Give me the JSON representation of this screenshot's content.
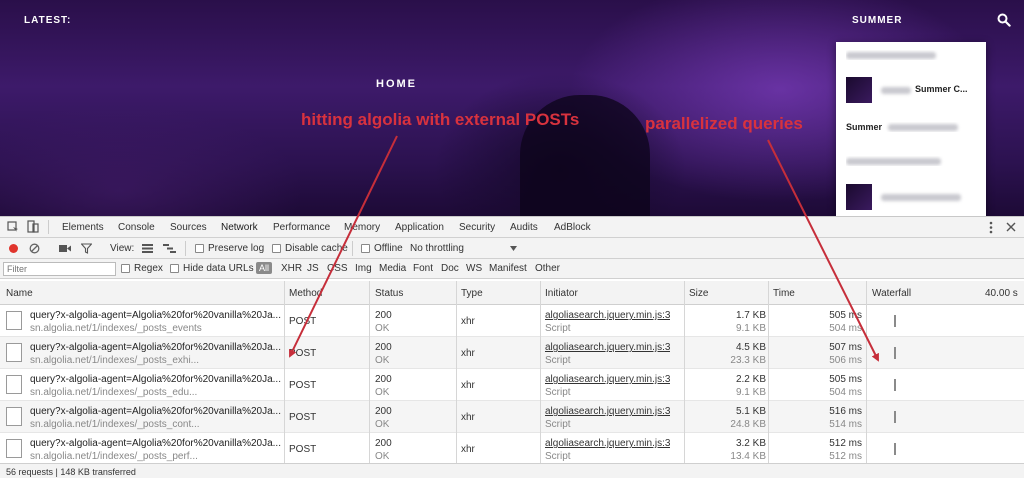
{
  "site": {
    "latest_label": "LATEST:",
    "summer_label": "SUMMER",
    "home_label": "HOME",
    "search_icon": "search-icon",
    "dropdown": {
      "items": [
        {
          "label": "",
          "has_thumb": false
        },
        {
          "label": "Summer C...",
          "has_thumb": true
        },
        {
          "label": "Summer",
          "has_thumb": false
        },
        {
          "label": "",
          "has_thumb": false
        },
        {
          "label": "",
          "has_thumb": true
        }
      ]
    }
  },
  "annotations": {
    "left": "hitting algolia with external POSTs",
    "right": "parallelized queries",
    "color": "#d8323e"
  },
  "devtools": {
    "tabs": [
      "Elements",
      "Console",
      "Sources",
      "Network",
      "Performance",
      "Memory",
      "Application",
      "Security",
      "Audits",
      "AdBlock"
    ],
    "active_tab": "Network",
    "toolbar": {
      "view_label": "View:",
      "preserve_log": "Preserve log",
      "disable_cache": "Disable cache",
      "offline": "Offline",
      "throttling": "No throttling"
    },
    "filter": {
      "placeholder": "Filter",
      "regex": "Regex",
      "hide_data_urls": "Hide data URLs",
      "all": "All",
      "types": [
        "XHR",
        "JS",
        "CSS",
        "Img",
        "Media",
        "Font",
        "Doc",
        "WS",
        "Manifest",
        "Other"
      ]
    },
    "columns": {
      "name": "Name",
      "method": "Method",
      "status": "Status",
      "type": "Type",
      "initiator": "Initiator",
      "size": "Size",
      "time": "Time",
      "waterfall": "Waterfall",
      "waterfall_scale": "40.00 s"
    },
    "requests": [
      {
        "name": "query?x-algolia-agent=Algolia%20for%20vanilla%20Ja...",
        "path": "sn.algolia.net/1/indexes/_posts_events",
        "method": "POST",
        "status": "200",
        "status_text": "OK",
        "type": "xhr",
        "initiator": "algoliasearch.jquery.min.js:3",
        "initiator_sub": "Script",
        "size": "1.7 KB",
        "size_sub": "9.1 KB",
        "time": "505 ms",
        "time_sub": "504 ms"
      },
      {
        "name": "query?x-algolia-agent=Algolia%20for%20vanilla%20Ja...",
        "path": "sn.algolia.net/1/indexes/_posts_exhi...",
        "method": "POST",
        "status": "200",
        "status_text": "OK",
        "type": "xhr",
        "initiator": "algoliasearch.jquery.min.js:3",
        "initiator_sub": "Script",
        "size": "4.5 KB",
        "size_sub": "23.3 KB",
        "time": "507 ms",
        "time_sub": "506 ms"
      },
      {
        "name": "query?x-algolia-agent=Algolia%20for%20vanilla%20Ja...",
        "path": "sn.algolia.net/1/indexes/_posts_edu...",
        "method": "POST",
        "status": "200",
        "status_text": "OK",
        "type": "xhr",
        "initiator": "algoliasearch.jquery.min.js:3",
        "initiator_sub": "Script",
        "size": "2.2 KB",
        "size_sub": "9.1 KB",
        "time": "505 ms",
        "time_sub": "504 ms"
      },
      {
        "name": "query?x-algolia-agent=Algolia%20for%20vanilla%20Ja...",
        "path": "sn.algolia.net/1/indexes/_posts_cont...",
        "method": "POST",
        "status": "200",
        "status_text": "OK",
        "type": "xhr",
        "initiator": "algoliasearch.jquery.min.js:3",
        "initiator_sub": "Script",
        "size": "5.1 KB",
        "size_sub": "24.8 KB",
        "time": "516 ms",
        "time_sub": "514 ms"
      },
      {
        "name": "query?x-algolia-agent=Algolia%20for%20vanilla%20Ja...",
        "path": "sn.algolia.net/1/indexes/_posts_perf...",
        "method": "POST",
        "status": "200",
        "status_text": "OK",
        "type": "xhr",
        "initiator": "algoliasearch.jquery.min.js:3",
        "initiator_sub": "Script",
        "size": "3.2 KB",
        "size_sub": "13.4 KB",
        "time": "512 ms",
        "time_sub": "512 ms"
      }
    ],
    "status_bar": "56 requests | 148 KB transferred"
  }
}
